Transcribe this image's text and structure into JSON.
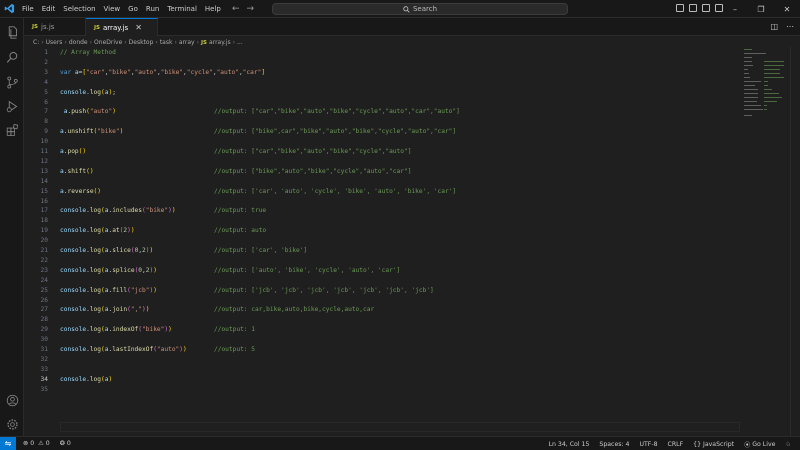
{
  "titlebar": {
    "menu": [
      "File",
      "Edit",
      "Selection",
      "View",
      "Go",
      "Run",
      "Terminal",
      "Help"
    ],
    "search_label": "Search",
    "colors": {
      "accent": "#0078d4",
      "logo": "#3b9ae1"
    }
  },
  "tabs": [
    {
      "label": "js.js",
      "icon": "JS",
      "active": false
    },
    {
      "label": "array.js",
      "icon": "JS",
      "active": true
    }
  ],
  "breadcrumb": [
    "C:",
    "Users",
    "donde",
    "OneDrive",
    "Desktop",
    "task",
    "array",
    "array.js",
    "..."
  ],
  "breadcrumb_file_icon": "JS",
  "editor": {
    "lines": [
      {
        "n": "1",
        "code": [
          {
            "t": "// Array Method",
            "c": "t-cm"
          }
        ],
        "out": ""
      },
      {
        "n": "2",
        "code": [],
        "out": ""
      },
      {
        "n": "3",
        "code": [
          {
            "t": "var ",
            "c": "t-kw"
          },
          {
            "t": "a",
            "c": "t-var"
          },
          {
            "t": "=",
            "c": "t-punc"
          },
          {
            "t": "[",
            "c": "t-br"
          },
          {
            "t": "\"car\"",
            "c": "t-str"
          },
          {
            "t": ",",
            "c": "t-punc"
          },
          {
            "t": "\"bike\"",
            "c": "t-str"
          },
          {
            "t": ",",
            "c": "t-punc"
          },
          {
            "t": "\"auto\"",
            "c": "t-str"
          },
          {
            "t": ",",
            "c": "t-punc"
          },
          {
            "t": "\"bike\"",
            "c": "t-str"
          },
          {
            "t": ",",
            "c": "t-punc"
          },
          {
            "t": "\"cycle\"",
            "c": "t-str"
          },
          {
            "t": ",",
            "c": "t-punc"
          },
          {
            "t": "\"auto\"",
            "c": "t-str"
          },
          {
            "t": ",",
            "c": "t-punc"
          },
          {
            "t": "\"car\"",
            "c": "t-str"
          },
          {
            "t": "]",
            "c": "t-br"
          }
        ],
        "out": ""
      },
      {
        "n": "4",
        "code": [],
        "out": ""
      },
      {
        "n": "5",
        "code": [
          {
            "t": "console",
            "c": "t-var"
          },
          {
            "t": ".",
            "c": "t-punc"
          },
          {
            "t": "log",
            "c": "t-fn"
          },
          {
            "t": "(",
            "c": "t-br"
          },
          {
            "t": "a",
            "c": "t-var"
          },
          {
            "t": ")",
            "c": "t-br"
          },
          {
            "t": ";",
            "c": "t-punc"
          }
        ],
        "out": ""
      },
      {
        "n": "6",
        "code": [],
        "out": ""
      },
      {
        "n": "7",
        "code": [
          {
            "t": " a",
            "c": "t-var"
          },
          {
            "t": ".",
            "c": "t-punc"
          },
          {
            "t": "push",
            "c": "t-fn"
          },
          {
            "t": "(",
            "c": "t-br"
          },
          {
            "t": "\"auto\"",
            "c": "t-str"
          },
          {
            "t": ")",
            "c": "t-br"
          }
        ],
        "out": "//output: [\"car\",\"bike\",\"auto\",\"bike\",\"cycle\",\"auto\",\"car\",\"auto\"]"
      },
      {
        "n": "8",
        "code": [],
        "out": ""
      },
      {
        "n": "9",
        "code": [
          {
            "t": "a",
            "c": "t-var"
          },
          {
            "t": ".",
            "c": "t-punc"
          },
          {
            "t": "unshift",
            "c": "t-fn"
          },
          {
            "t": "(",
            "c": "t-br"
          },
          {
            "t": "\"bike\"",
            "c": "t-str"
          },
          {
            "t": ")",
            "c": "t-br"
          }
        ],
        "out": "//output: [\"bike\",car\",\"bike\",\"auto\",\"bike\",\"cycle\",\"auto\",\"car\"]"
      },
      {
        "n": "10",
        "code": [],
        "out": ""
      },
      {
        "n": "11",
        "code": [
          {
            "t": "a",
            "c": "t-var"
          },
          {
            "t": ".",
            "c": "t-punc"
          },
          {
            "t": "pop",
            "c": "t-fn"
          },
          {
            "t": "()",
            "c": "t-br"
          }
        ],
        "out": "//output: [\"car\",\"bike\",\"auto\",\"bike\",\"cycle\",\"auto\"]"
      },
      {
        "n": "12",
        "code": [],
        "out": ""
      },
      {
        "n": "13",
        "code": [
          {
            "t": "a",
            "c": "t-var"
          },
          {
            "t": ".",
            "c": "t-punc"
          },
          {
            "t": "shift",
            "c": "t-fn"
          },
          {
            "t": "()",
            "c": "t-br"
          }
        ],
        "out": "//output: [\"bike\",\"auto\",\"bike\",\"cycle\",\"auto\",\"car\"]"
      },
      {
        "n": "14",
        "code": [],
        "out": ""
      },
      {
        "n": "15",
        "code": [
          {
            "t": "a",
            "c": "t-var"
          },
          {
            "t": ".",
            "c": "t-punc"
          },
          {
            "t": "reverse",
            "c": "t-fn"
          },
          {
            "t": "()",
            "c": "t-br"
          }
        ],
        "out": "//output: ['car', 'auto', 'cycle', 'bike', 'auto', 'bike', 'car']"
      },
      {
        "n": "16",
        "code": [],
        "out": ""
      },
      {
        "n": "17",
        "code": [
          {
            "t": "console",
            "c": "t-var"
          },
          {
            "t": ".",
            "c": "t-punc"
          },
          {
            "t": "log",
            "c": "t-fn"
          },
          {
            "t": "(",
            "c": "t-br"
          },
          {
            "t": "a",
            "c": "t-var"
          },
          {
            "t": ".",
            "c": "t-punc"
          },
          {
            "t": "includes",
            "c": "t-fn"
          },
          {
            "t": "(",
            "c": "t-br2"
          },
          {
            "t": "\"bike\"",
            "c": "t-str"
          },
          {
            "t": ")",
            "c": "t-br2"
          },
          {
            "t": ")",
            "c": "t-br"
          }
        ],
        "out": "//output: true"
      },
      {
        "n": "18",
        "code": [],
        "out": ""
      },
      {
        "n": "19",
        "code": [
          {
            "t": "console",
            "c": "t-var"
          },
          {
            "t": ".",
            "c": "t-punc"
          },
          {
            "t": "log",
            "c": "t-fn"
          },
          {
            "t": "(",
            "c": "t-br"
          },
          {
            "t": "a",
            "c": "t-var"
          },
          {
            "t": ".",
            "c": "t-punc"
          },
          {
            "t": "at",
            "c": "t-fn"
          },
          {
            "t": "(",
            "c": "t-br2"
          },
          {
            "t": "2",
            "c": "t-num"
          },
          {
            "t": ")",
            "c": "t-br2"
          },
          {
            "t": ")",
            "c": "t-br"
          }
        ],
        "out": "//output: auto"
      },
      {
        "n": "20",
        "code": [],
        "out": ""
      },
      {
        "n": "21",
        "code": [
          {
            "t": "console",
            "c": "t-var"
          },
          {
            "t": ".",
            "c": "t-punc"
          },
          {
            "t": "log",
            "c": "t-fn"
          },
          {
            "t": "(",
            "c": "t-br"
          },
          {
            "t": "a",
            "c": "t-var"
          },
          {
            "t": ".",
            "c": "t-punc"
          },
          {
            "t": "slice",
            "c": "t-fn"
          },
          {
            "t": "(",
            "c": "t-br2"
          },
          {
            "t": "0",
            "c": "t-num"
          },
          {
            "t": ",",
            "c": "t-punc"
          },
          {
            "t": "2",
            "c": "t-num"
          },
          {
            "t": ")",
            "c": "t-br2"
          },
          {
            "t": ")",
            "c": "t-br"
          }
        ],
        "out": "//output: ['car', 'bike']"
      },
      {
        "n": "22",
        "code": [],
        "out": ""
      },
      {
        "n": "23",
        "code": [
          {
            "t": "console",
            "c": "t-var"
          },
          {
            "t": ".",
            "c": "t-punc"
          },
          {
            "t": "log",
            "c": "t-fn"
          },
          {
            "t": "(",
            "c": "t-br"
          },
          {
            "t": "a",
            "c": "t-var"
          },
          {
            "t": ".",
            "c": "t-punc"
          },
          {
            "t": "splice",
            "c": "t-fn"
          },
          {
            "t": "(",
            "c": "t-br2"
          },
          {
            "t": "0",
            "c": "t-num"
          },
          {
            "t": ",",
            "c": "t-punc"
          },
          {
            "t": "2",
            "c": "t-num"
          },
          {
            "t": ")",
            "c": "t-br2"
          },
          {
            "t": ")",
            "c": "t-br"
          }
        ],
        "out": "//output: ['auto', 'bike', 'cycle', 'auto', 'car']"
      },
      {
        "n": "24",
        "code": [],
        "out": ""
      },
      {
        "n": "25",
        "code": [
          {
            "t": "console",
            "c": "t-var"
          },
          {
            "t": ".",
            "c": "t-punc"
          },
          {
            "t": "log",
            "c": "t-fn"
          },
          {
            "t": "(",
            "c": "t-br"
          },
          {
            "t": "a",
            "c": "t-var"
          },
          {
            "t": ".",
            "c": "t-punc"
          },
          {
            "t": "fill",
            "c": "t-fn"
          },
          {
            "t": "(",
            "c": "t-br2"
          },
          {
            "t": "\"jcb\"",
            "c": "t-str"
          },
          {
            "t": ")",
            "c": "t-br2"
          },
          {
            "t": ")",
            "c": "t-br"
          }
        ],
        "out": "//output: ['jcb', 'jcb', 'jcb', 'jcb', 'jcb', 'jcb', 'jcb']"
      },
      {
        "n": "26",
        "code": [],
        "out": ""
      },
      {
        "n": "27",
        "code": [
          {
            "t": "console",
            "c": "t-var"
          },
          {
            "t": ".",
            "c": "t-punc"
          },
          {
            "t": "log",
            "c": "t-fn"
          },
          {
            "t": "(",
            "c": "t-br"
          },
          {
            "t": "a",
            "c": "t-var"
          },
          {
            "t": ".",
            "c": "t-punc"
          },
          {
            "t": "join",
            "c": "t-fn"
          },
          {
            "t": "(",
            "c": "t-br2"
          },
          {
            "t": "\",\"",
            "c": "t-str"
          },
          {
            "t": ")",
            "c": "t-br2"
          },
          {
            "t": ")",
            "c": "t-br"
          }
        ],
        "out": "//output: car,bike,auto,bike,cycle,auto,car"
      },
      {
        "n": "28",
        "code": [],
        "out": ""
      },
      {
        "n": "29",
        "code": [
          {
            "t": "console",
            "c": "t-var"
          },
          {
            "t": ".",
            "c": "t-punc"
          },
          {
            "t": "log",
            "c": "t-fn"
          },
          {
            "t": "(",
            "c": "t-br"
          },
          {
            "t": "a",
            "c": "t-var"
          },
          {
            "t": ".",
            "c": "t-punc"
          },
          {
            "t": "indexOf",
            "c": "t-fn"
          },
          {
            "t": "(",
            "c": "t-br2"
          },
          {
            "t": "\"bike\"",
            "c": "t-str"
          },
          {
            "t": ")",
            "c": "t-br2"
          },
          {
            "t": ")",
            "c": "t-br"
          }
        ],
        "out": "//output: 1"
      },
      {
        "n": "30",
        "code": [],
        "out": ""
      },
      {
        "n": "31",
        "code": [
          {
            "t": "console",
            "c": "t-var"
          },
          {
            "t": ".",
            "c": "t-punc"
          },
          {
            "t": "log",
            "c": "t-fn"
          },
          {
            "t": "(",
            "c": "t-br"
          },
          {
            "t": "a",
            "c": "t-var"
          },
          {
            "t": ".",
            "c": "t-punc"
          },
          {
            "t": "lastIndexOf",
            "c": "t-fn"
          },
          {
            "t": "(",
            "c": "t-br2"
          },
          {
            "t": "\"auto\"",
            "c": "t-str"
          },
          {
            "t": ")",
            "c": "t-br2"
          },
          {
            "t": ")",
            "c": "t-br"
          }
        ],
        "out": "//output: 5"
      },
      {
        "n": "32",
        "code": [],
        "out": ""
      },
      {
        "n": "33",
        "code": [],
        "out": ""
      },
      {
        "n": "34",
        "code": [
          {
            "t": "console",
            "c": "t-var"
          },
          {
            "t": ".",
            "c": "t-punc"
          },
          {
            "t": "log",
            "c": "t-fn"
          },
          {
            "t": "(",
            "c": "t-br"
          },
          {
            "t": "a",
            "c": "t-var"
          },
          {
            "t": ")",
            "c": "t-br"
          }
        ],
        "out": "",
        "current": true
      },
      {
        "n": "35",
        "code": [],
        "out": ""
      }
    ]
  },
  "statusbar": {
    "errors": "0",
    "warnings": "0",
    "ports": "0",
    "position": "Ln 34, Col 15",
    "spaces": "Spaces: 4",
    "encoding": "UTF-8",
    "eol": "CRLF",
    "language": "JavaScript",
    "golive": "Go Live"
  }
}
